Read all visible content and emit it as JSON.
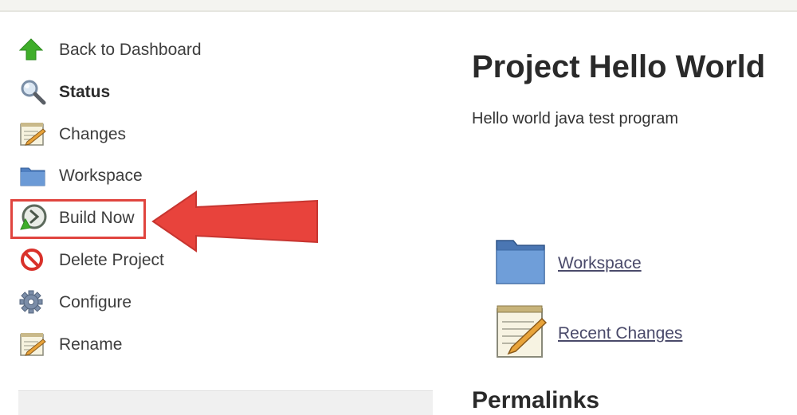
{
  "sidebar": {
    "items": [
      {
        "label": "Back to Dashboard",
        "icon": "up-arrow-icon"
      },
      {
        "label": "Status",
        "icon": "search-icon"
      },
      {
        "label": "Changes",
        "icon": "notepad-icon"
      },
      {
        "label": "Workspace",
        "icon": "folder-icon"
      },
      {
        "label": "Build Now",
        "icon": "build-clock-icon"
      },
      {
        "label": "Delete Project",
        "icon": "no-entry-icon"
      },
      {
        "label": "Configure",
        "icon": "gear-icon"
      },
      {
        "label": "Rename",
        "icon": "notepad-icon"
      }
    ]
  },
  "main": {
    "title": "Project Hello World",
    "description": "Hello world java test program",
    "links": [
      {
        "label": "Workspace",
        "icon": "folder-icon"
      },
      {
        "label": "Recent Changes",
        "icon": "notepad-icon"
      }
    ],
    "permalinks_heading": "Permalinks"
  },
  "annotation": {
    "color": "#e0443e",
    "target": "Build Now"
  }
}
